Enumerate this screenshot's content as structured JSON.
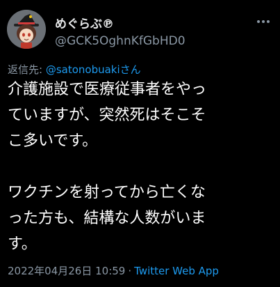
{
  "user": {
    "display_name": "めぐらぶ℗",
    "handle": "@GCK5OghnKfGbHD0"
  },
  "reply": {
    "prefix": "返信先: ",
    "mention": "@satonobuakiさん"
  },
  "body": {
    "line1": "介護施設で医療従事者をやっ",
    "line2": "ていますが、突然死はそこそ",
    "line3": "こ多いです。",
    "line4": "ワクチンを射ってから亡くな",
    "line5": "った方も、結構な人数がいま",
    "line6": "す。"
  },
  "meta": {
    "timestamp": "2022年04月26日 10:59",
    "separator": "·",
    "source": "Twitter Web App"
  },
  "icons": {
    "more": "more-horizontal-icon",
    "avatar": "avatar-illustration"
  },
  "colors": {
    "background": "#000000",
    "text": "#ffffff",
    "secondary": "#8b98a5",
    "link": "#1d9bf0"
  }
}
